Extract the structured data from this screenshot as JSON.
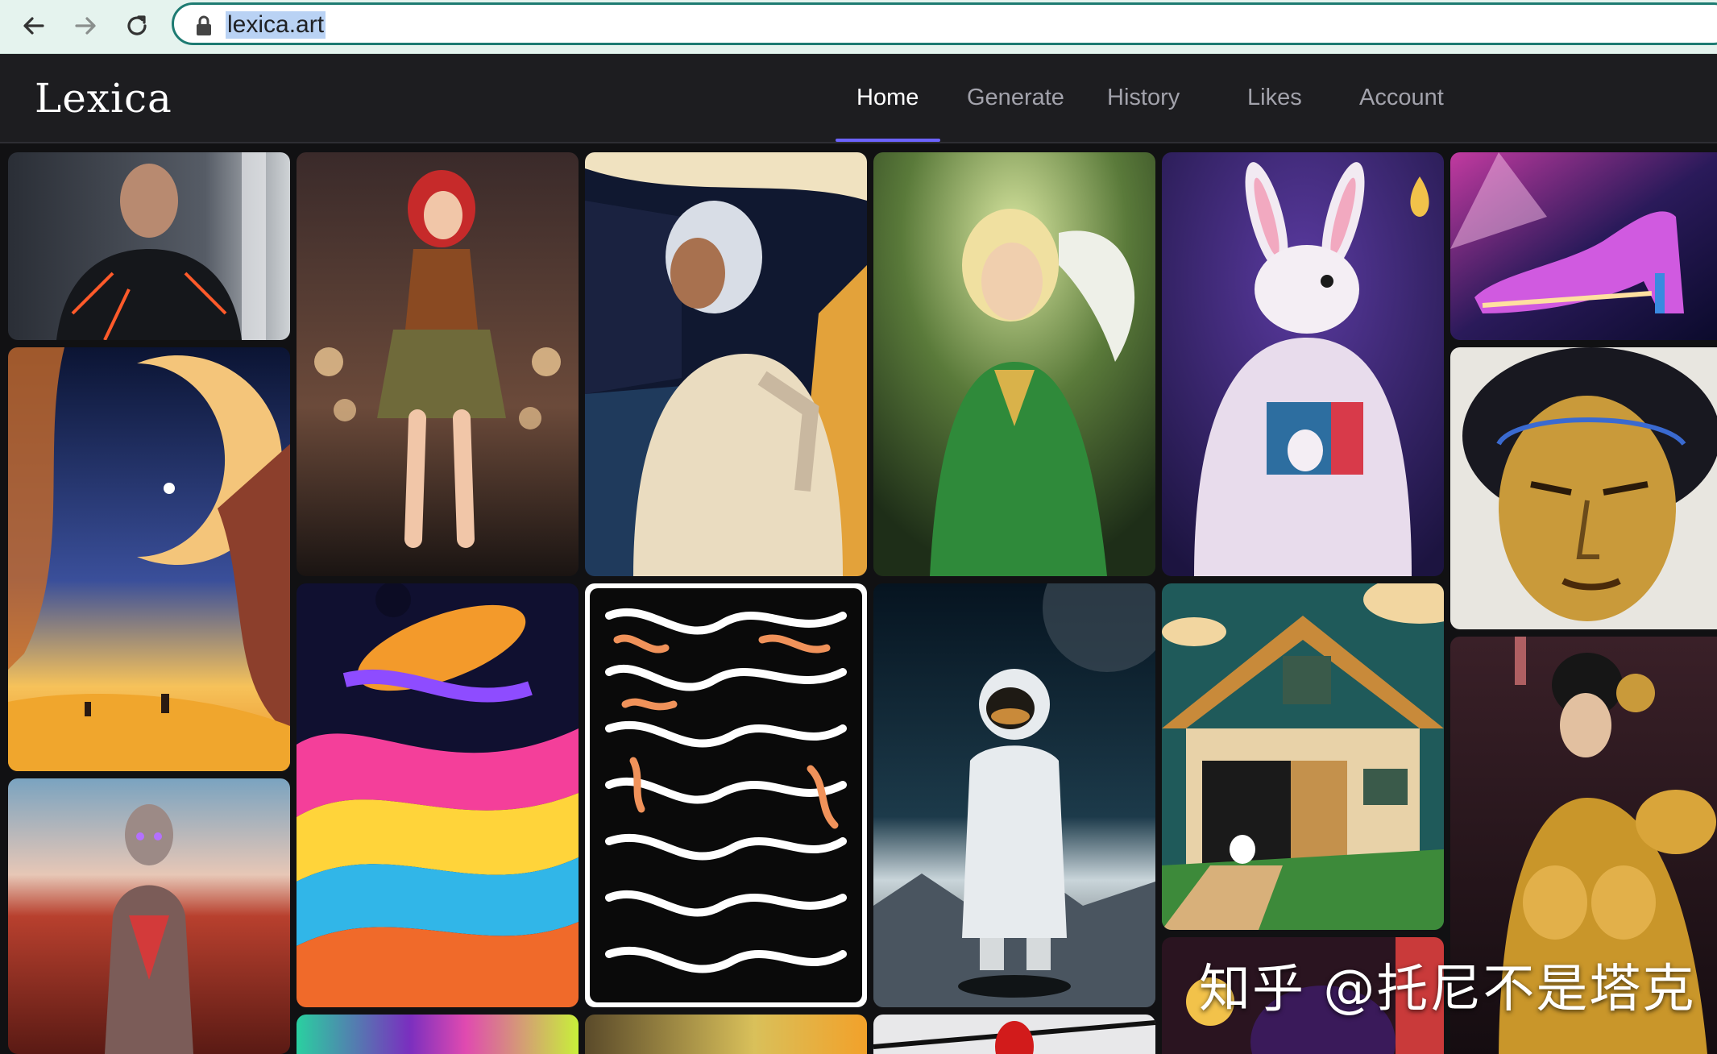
{
  "browser": {
    "back_icon": "arrow-left-icon",
    "forward_icon": "arrow-right-icon",
    "reload_icon": "reload-icon",
    "lock_icon": "lock-icon",
    "url": "lexica.art"
  },
  "app": {
    "logo": "Lexica",
    "nav": [
      {
        "label": "Home",
        "active": true
      },
      {
        "label": "Generate",
        "active": false
      },
      {
        "label": "History",
        "active": false
      },
      {
        "label": "Likes",
        "active": false
      },
      {
        "label": "Account",
        "active": false
      }
    ],
    "accent_color": "#6c63ff"
  },
  "gallery": {
    "tiles": [
      "cyborg-man-armor",
      "red-haired-woman-dress",
      "retro-astronaut-woman",
      "elf-woman-green",
      "rabbit-in-hoodie",
      "neon-high-heel-shoe",
      "desert-planet-landscape",
      "golden-mask-face",
      "psychedelic-swirl-planet",
      "black-white-maze",
      "astronaut-on-moon",
      "pixel-house-rabbit",
      "golden-armor-asian-woman",
      "robot-woman-desert",
      "colorful-abstract",
      "blurred-yellow",
      "red-object",
      "anime-character"
    ]
  },
  "watermark": "知乎 @托尼不是塔克"
}
